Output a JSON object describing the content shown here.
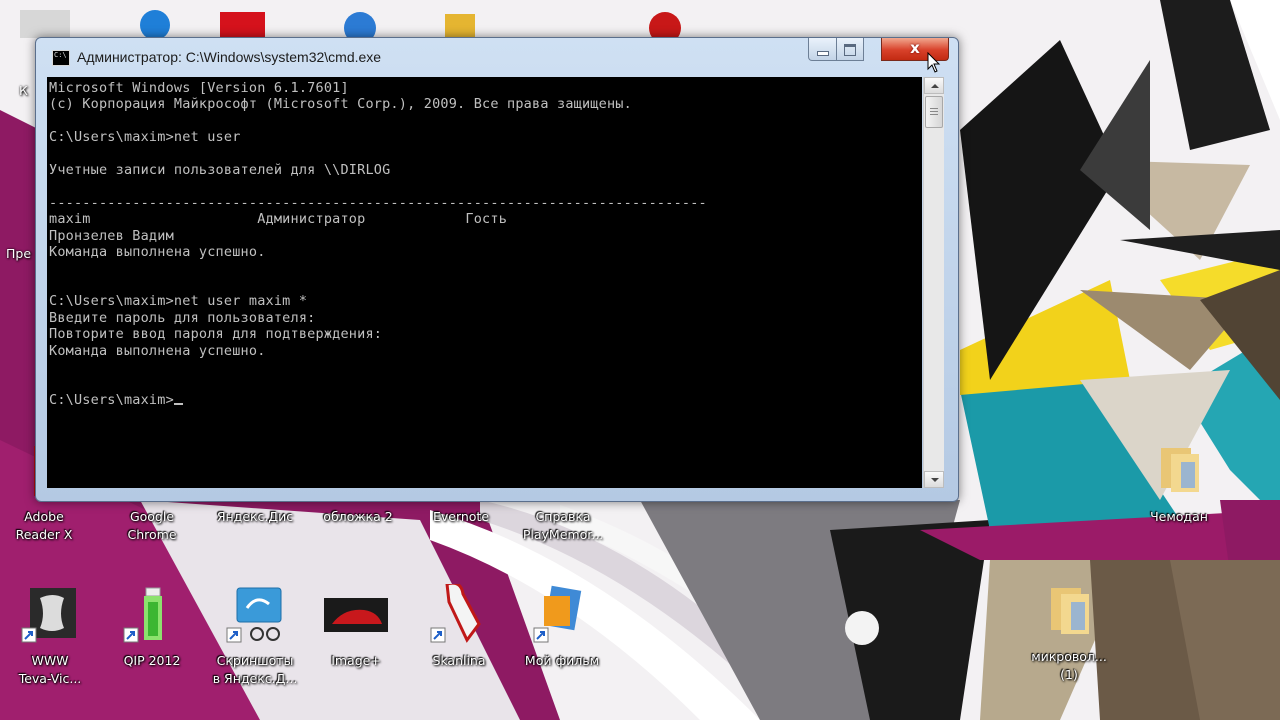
{
  "window": {
    "title": "Администратор: C:\\Windows\\system32\\cmd.exe",
    "icon": "cmd-icon",
    "close_glyph": "x",
    "icon_text": "C:\\"
  },
  "console": {
    "lines": [
      "Microsoft Windows [Version 6.1.7601]",
      "(c) Корпорация Майкрософт (Microsoft Corp.), 2009. Все права защищены.",
      "",
      "C:\\Users\\maxim>net user",
      "",
      "Учетные записи пользователей для \\\\DIRLOG",
      "",
      "-------------------------------------------------------------------------------",
      "maxim                    Администратор            Гость",
      "Пронзелев Вадим",
      "Команда выполнена успешно.",
      "",
      "",
      "C:\\Users\\maxim>net user maxim *",
      "Введите пароль для пользователя:",
      "Повторите ввод пароля для подтверждения:",
      "Команда выполнена успешно.",
      "",
      "",
      "C:\\Users\\maxim>"
    ]
  },
  "desktop_icons": [
    {
      "label": "Adobe\nReader X",
      "icon": "adobe-reader-icon"
    },
    {
      "label": "Google\nChrome",
      "icon": "chrome-icon"
    },
    {
      "label": "Яндекс.Дис",
      "icon": "yandex-disk-icon"
    },
    {
      "label": "обложка 2",
      "icon": "image-file-icon"
    },
    {
      "label": "Evernote",
      "icon": "evernote-icon"
    },
    {
      "label": "Справка\nPlayMemor...",
      "icon": "help-icon"
    },
    {
      "label": "Чемодан",
      "icon": "folder-icon"
    },
    {
      "label": "WWW\nTeva-Vic...",
      "icon": "www-shortcut-icon"
    },
    {
      "label": "QIP 2012",
      "icon": "qip-icon"
    },
    {
      "label": "Скриншоты\nв Яндекс.Д...",
      "icon": "yandex-screenshots-icon"
    },
    {
      "label": "Image+",
      "icon": "car-image-icon"
    },
    {
      "label": "Skanlina",
      "icon": "skanlina-icon"
    },
    {
      "label": "Мой фильм",
      "icon": "movie-maker-icon"
    },
    {
      "label": "микровол...\n(1)",
      "icon": "folder-icon"
    }
  ],
  "edge_labels": [
    "К",
    "Пре"
  ],
  "colors": {
    "magenta": "#8e1a63",
    "teal": "#1b9aa8",
    "yellow": "#f2d21b",
    "close_red": "#d8412a",
    "console_bg": "#000000",
    "console_fg": "#c0c0c0"
  }
}
